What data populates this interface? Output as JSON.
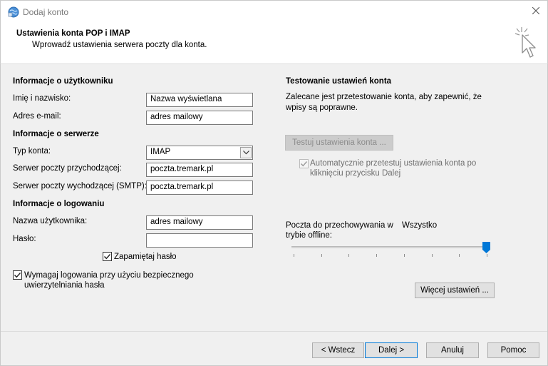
{
  "window": {
    "title": "Dodaj konto",
    "close_icon": "close-icon",
    "app_icon": "outlook-globe-icon"
  },
  "header": {
    "title": "Ustawienia konta POP i IMAP",
    "subtitle": "Wprowadź ustawienia serwera poczty dla konta.",
    "icon": "cursor-click-icon"
  },
  "user_info": {
    "section_label": "Informacje o użytkowniku",
    "name_label": "Imię i nazwisko:",
    "name_value": "Nazwa wyświetlana",
    "email_label": "Adres e-mail:",
    "email_value": "adres mailowy"
  },
  "server_info": {
    "section_label": "Informacje o serwerze",
    "account_type_label": "Typ konta:",
    "account_type_value": "IMAP",
    "incoming_label": "Serwer poczty przychodzącej:",
    "incoming_value": "poczta.tremark.pl",
    "outgoing_label": "Serwer poczty wychodzącej (SMTP):",
    "outgoing_value": "poczta.tremark.pl"
  },
  "login_info": {
    "section_label": "Informacje o logowaniu",
    "username_label": "Nazwa użytkownika:",
    "username_value": "adres mailowy",
    "password_label": "Hasło:",
    "password_value": "",
    "remember_label": "Zapamiętaj hasło",
    "remember_checked": true,
    "spa_label_line1": "Wymagaj logowania przy użyciu bezpiecznego",
    "spa_label_line2": "uwierzytelniania hasła",
    "spa_checked": true
  },
  "test": {
    "section_label": "Testowanie ustawień konta",
    "desc_line1": "Zalecane jest przetestowanie konta, aby zapewnić, że",
    "desc_line2": "wpisy są poprawne.",
    "test_button": "Testuj ustawienia konta ...",
    "auto_label_line1": "Automatycznie przetestuj ustawienia konta po",
    "auto_label_line2": "kliknięciu przycisku Dalej",
    "auto_checked": true
  },
  "offline": {
    "label_line1": "Poczta do przechowywania w",
    "label_line2": "trybie offline:",
    "value": "Wszystko",
    "slider_fraction": 1.0
  },
  "more_settings_button": "Więcej ustawień ...",
  "footer": {
    "back": "< Wstecz",
    "next": "Dalej >",
    "cancel": "Anuluj",
    "help": "Pomoc"
  }
}
